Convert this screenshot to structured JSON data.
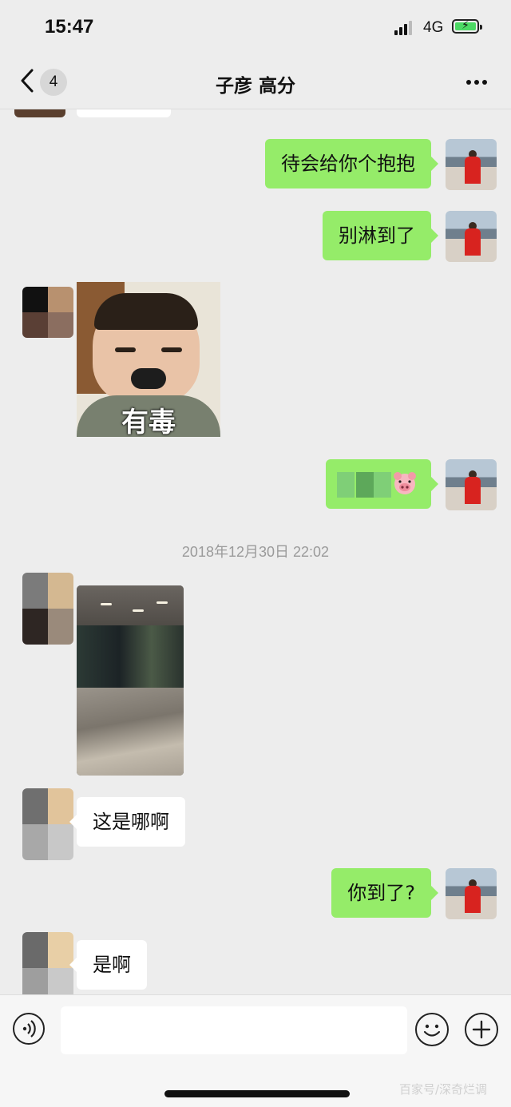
{
  "status_bar": {
    "time": "15:47",
    "network": "4G"
  },
  "nav": {
    "unread_count": "4",
    "title": "子彦 高分"
  },
  "messages": [
    {
      "side": "right",
      "text": "待会给你个抱抱"
    },
    {
      "side": "right",
      "text": "别淋到了"
    },
    {
      "side": "left",
      "type": "sticker",
      "caption": "有毒"
    },
    {
      "side": "right",
      "type": "emoji-text"
    },
    {
      "type": "timestamp",
      "text": "2018年12月30日 22:02"
    },
    {
      "side": "left",
      "type": "photo"
    },
    {
      "side": "left",
      "text": "这是哪啊"
    },
    {
      "side": "right",
      "text": "你到了?"
    },
    {
      "side": "left",
      "text": "是啊"
    }
  ],
  "icons": {
    "back": "chevron-left-icon",
    "more": "more-dots-icon",
    "voice": "voice-icon",
    "emoji": "smiley-icon",
    "plus": "plus-icon",
    "pig": "pig-face-icon"
  },
  "colors": {
    "my_bubble": "#95ec69",
    "their_bubble": "#ffffff",
    "background": "#ededed"
  },
  "watermark": "百家号/深奇烂调"
}
